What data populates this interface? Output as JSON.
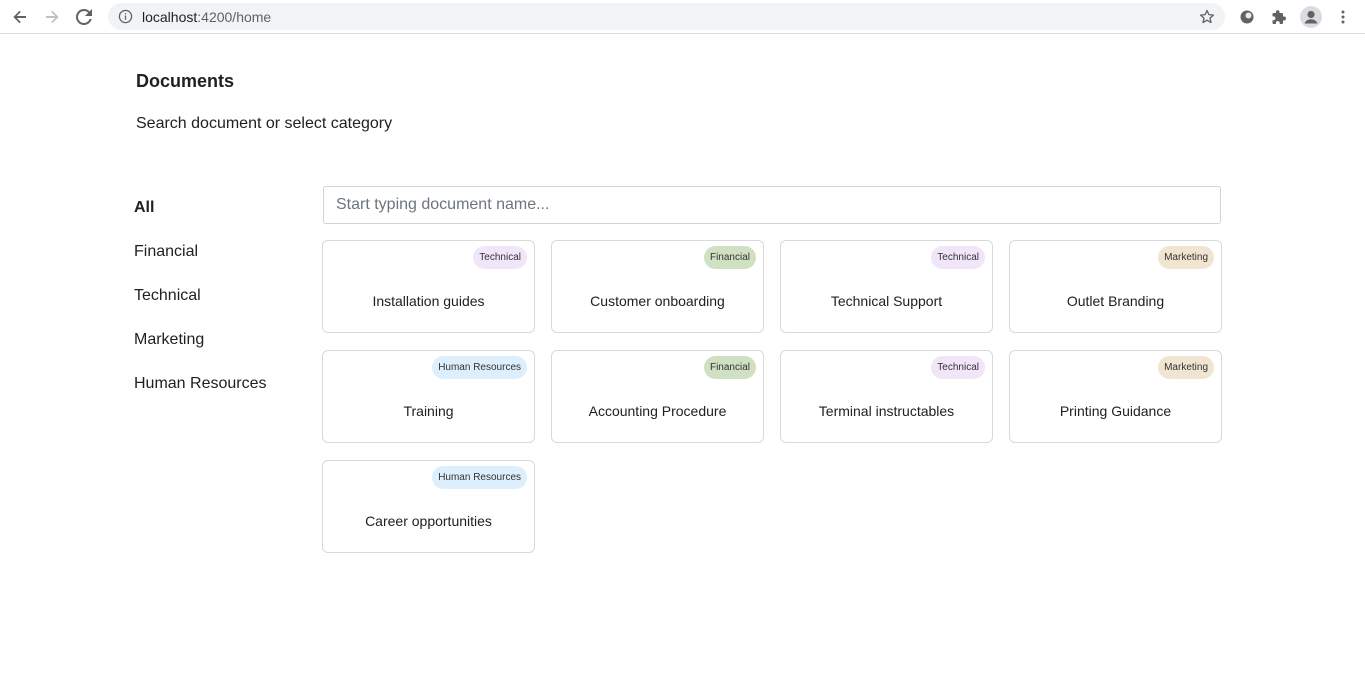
{
  "browser": {
    "url_host": "localhost",
    "url_rest": ":4200/home"
  },
  "page": {
    "title": "Documents",
    "subtitle": "Search document or select category"
  },
  "categories": [
    {
      "label": "All",
      "active": true
    },
    {
      "label": "Financial",
      "active": false
    },
    {
      "label": "Technical",
      "active": false
    },
    {
      "label": "Marketing",
      "active": false
    },
    {
      "label": "Human Resources",
      "active": false
    }
  ],
  "search": {
    "placeholder": "Start typing document name...",
    "value": ""
  },
  "documents": [
    {
      "title": "Installation guides",
      "category": "Technical",
      "badge_class": "technical"
    },
    {
      "title": "Customer onboarding",
      "category": "Financial",
      "badge_class": "financial"
    },
    {
      "title": "Technical Support",
      "category": "Technical",
      "badge_class": "technical"
    },
    {
      "title": "Outlet Branding",
      "category": "Marketing",
      "badge_class": "marketing"
    },
    {
      "title": "Training",
      "category": "Human Resources",
      "badge_class": "hr"
    },
    {
      "title": "Accounting Procedure",
      "category": "Financial",
      "badge_class": "financial"
    },
    {
      "title": "Terminal instructables",
      "category": "Technical",
      "badge_class": "technical"
    },
    {
      "title": "Printing Guidance",
      "category": "Marketing",
      "badge_class": "marketing"
    },
    {
      "title": "Career opportunities",
      "category": "Human Resources",
      "badge_class": "hr"
    }
  ],
  "colors": {
    "technical_badge": "#f1e5fa",
    "financial_badge": "#cfe0c3",
    "marketing_badge": "#f1e5d1",
    "hr_badge": "#ddeefc"
  }
}
